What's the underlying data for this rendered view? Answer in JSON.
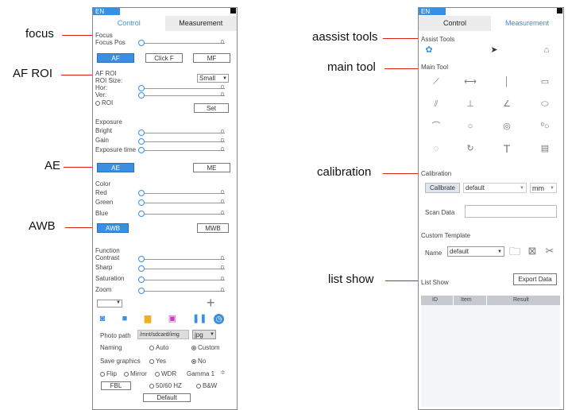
{
  "callouts_left": {
    "focus": "focus",
    "af_roi": "AF ROI",
    "ae": "AE",
    "awb": "AWB"
  },
  "callouts_right": {
    "assist": "aassist tools",
    "main": "main tool",
    "calibration": "calibration",
    "list": "list show"
  },
  "colors": {
    "accent": "#3a8fe0",
    "callout_line": "#d21"
  },
  "left_panel": {
    "lang": "EN",
    "tabs": {
      "control": "Control",
      "measurement": "Measurement"
    },
    "focus": {
      "title": "Focus",
      "pos_label": "Focus Pos",
      "pos_value": "0",
      "btn_af": "AF",
      "btn_click": "Click F",
      "btn_mf": "MF"
    },
    "af_roi": {
      "title": "AF ROI",
      "size_label": "ROI Size:",
      "size_value": "Small",
      "hor_label": "Hor:",
      "hor_value": "0",
      "ver_label": "Ver:",
      "ver_value": "0",
      "roi_label": "ROI",
      "set_btn": "Set"
    },
    "exposure": {
      "title": "Exposure",
      "bright_label": "Bright",
      "bright_value": "0",
      "gain_label": "Gain",
      "gain_value": "0",
      "time_label": "Exposure time",
      "time_value": "0",
      "btn_ae": "AE",
      "btn_me": "ME"
    },
    "color": {
      "title": "Color",
      "red_label": "Red",
      "red_value": "0",
      "green_label": "Green",
      "green_value": "0",
      "blue_label": "Blue",
      "blue_value": "0",
      "btn_awb": "AWB",
      "btn_mwb": "MWB"
    },
    "function": {
      "title": "Function",
      "contrast_label": "Contrast",
      "contrast_value": "0",
      "sharp_label": "Sharp",
      "sharp_value": "0",
      "saturation_label": "Saturation",
      "saturation_value": "0",
      "zoom_label": "Zoom",
      "zoom_value": "0"
    },
    "photo": {
      "path_label": "Photo path",
      "path_value": "/mnt/sdcard/img",
      "format": "jpg"
    },
    "naming": {
      "label": "Naming",
      "auto": "Auto",
      "custom": "Custom"
    },
    "save_graphics": {
      "label": "Save graphics",
      "yes": "Yes",
      "no": "No"
    },
    "misc": {
      "flip": "Flip",
      "mirror": "Mirror",
      "wdr": "WDR",
      "gamma": "Gamma 1",
      "fbl": "FBL",
      "hz": "50/60 HZ",
      "bw": "B&W",
      "default_btn": "Default"
    },
    "media_icons": [
      "camera-icon",
      "video-icon",
      "folder-icon",
      "gallery-icon",
      "pause-icon",
      "clock-icon"
    ]
  },
  "right_panel": {
    "lang": "EN",
    "tabs": {
      "control": "Control",
      "measurement": "Measurement"
    },
    "assist": {
      "title": "Assist Tools",
      "icons": [
        "palette-icon",
        "pointer-icon",
        "eraser-icon"
      ]
    },
    "main_tool": {
      "title": "Main Tool",
      "icons": [
        "line-icon",
        "hline-icon",
        "vline-icon",
        "rect-icon",
        "parallel-icon",
        "perpendicular-icon",
        "angle-icon",
        "polygon-icon",
        "arc-icon",
        "circle-icon",
        "concentric-icon",
        "point-circle-icon",
        "three-point-icon",
        "curve-icon",
        "text-icon",
        "ruler-icon"
      ]
    },
    "calibration": {
      "title": "Calibration",
      "btn": "Callbrate",
      "select": "default",
      "unit": "mm",
      "scan_label": "Scan Data"
    },
    "template": {
      "title": "Custom Template",
      "name_label": "Name",
      "name_value": "default"
    },
    "list": {
      "title": "List Show",
      "export_btn": "Export Data",
      "columns": [
        "ID",
        "Item",
        "Result"
      ]
    }
  }
}
